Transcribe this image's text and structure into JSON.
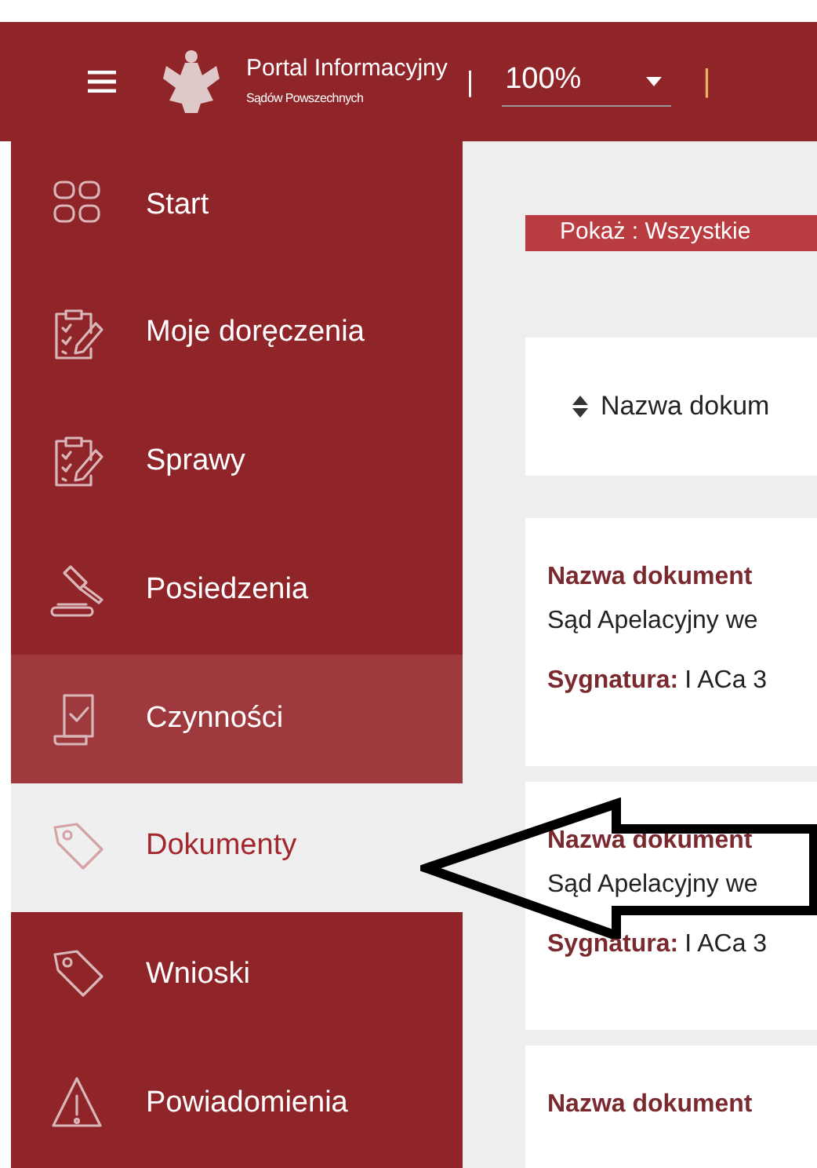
{
  "header": {
    "title": "Portal Informacyjny",
    "subtitle": "Sądów Powszechnych",
    "separators": [
      "|",
      "|"
    ],
    "zoom": {
      "value": "100%"
    }
  },
  "sidebar": {
    "items": [
      {
        "label": "Start",
        "selected": false,
        "hovered": false
      },
      {
        "label": "Moje doręczenia",
        "selected": false,
        "hovered": false
      },
      {
        "label": "Sprawy",
        "selected": false,
        "hovered": false
      },
      {
        "label": "Posiedzenia",
        "selected": false,
        "hovered": false
      },
      {
        "label": "Czynności",
        "selected": false,
        "hovered": true
      },
      {
        "label": "Dokumenty",
        "selected": true,
        "hovered": false
      },
      {
        "label": "Wnioski",
        "selected": false,
        "hovered": false
      },
      {
        "label": "Powiadomienia",
        "selected": false,
        "hovered": false
      }
    ]
  },
  "filter_button": "Pokaż : Wszystkie",
  "sort_header": {
    "label": "Nazwa dokum"
  },
  "documents": [
    {
      "title": "Nazwa dokument",
      "court": "Sąd Apelacyjny we",
      "signature_label": "Sygnatura:",
      "signature": "I ACa 3"
    },
    {
      "title": "Nazwa dokument",
      "court": "Sąd Apelacyjny we",
      "signature_label": "Sygnatura:",
      "signature": "I ACa 3"
    },
    {
      "title": "Nazwa dokument"
    }
  ]
}
